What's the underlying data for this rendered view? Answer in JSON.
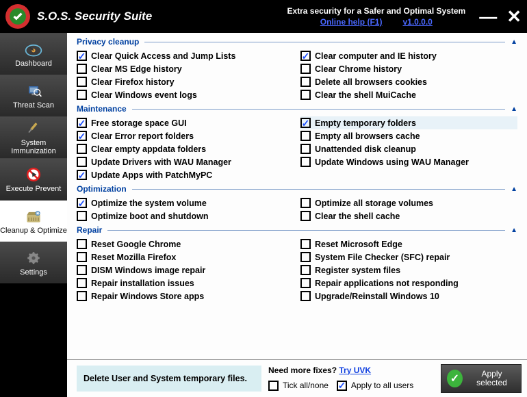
{
  "title": "S.O.S. Security Suite",
  "tagline": "Extra security for a Safer and Optimal System",
  "help_link": "Online help (F1)",
  "version": "v1.0.0.0",
  "sidebar": [
    {
      "label": "Dashboard"
    },
    {
      "label": "Threat Scan"
    },
    {
      "label": "System Immunization"
    },
    {
      "label": "Execute Prevent"
    },
    {
      "label": "Cleanup & Optimize"
    },
    {
      "label": "Settings"
    }
  ],
  "sections": {
    "privacy": {
      "title": "Privacy cleanup",
      "left": [
        {
          "label": "Clear Quick Access and Jump Lists",
          "checked": true
        },
        {
          "label": "Clear MS Edge history",
          "checked": false
        },
        {
          "label": "Clear Firefox history",
          "checked": false
        },
        {
          "label": "Clear Windows event logs",
          "checked": false
        }
      ],
      "right": [
        {
          "label": "Clear computer and IE history",
          "checked": true
        },
        {
          "label": "Clear Chrome history",
          "checked": false
        },
        {
          "label": "Delete all browsers cookies",
          "checked": false
        },
        {
          "label": "Clear the shell MuiCache",
          "checked": false
        }
      ]
    },
    "maintenance": {
      "title": "Maintenance",
      "left": [
        {
          "label": "Free storage space GUI",
          "checked": true
        },
        {
          "label": "Clear Error report folders",
          "checked": true
        },
        {
          "label": "Clear empty appdata folders",
          "checked": false
        },
        {
          "label": "Update Drivers with WAU Manager",
          "checked": false
        },
        {
          "label": "Update Apps with PatchMyPC",
          "checked": true
        }
      ],
      "right": [
        {
          "label": "Empty temporary folders",
          "checked": true,
          "hover": true
        },
        {
          "label": "Empty all browsers cache",
          "checked": false
        },
        {
          "label": "Unattended disk cleanup",
          "checked": false
        },
        {
          "label": "Update Windows using WAU Manager",
          "checked": false
        }
      ]
    },
    "optimization": {
      "title": "Optimization",
      "left": [
        {
          "label": "Optimize the system volume",
          "checked": true
        },
        {
          "label": "Optimize boot and shutdown",
          "checked": false
        }
      ],
      "right": [
        {
          "label": "Optimize all storage volumes",
          "checked": false
        },
        {
          "label": "Clear the shell cache",
          "checked": false
        }
      ]
    },
    "repair": {
      "title": "Repair",
      "left": [
        {
          "label": "Reset Google Chrome",
          "checked": false
        },
        {
          "label": "Reset Mozilla Firefox",
          "checked": false
        },
        {
          "label": "DISM Windows image repair",
          "checked": false
        },
        {
          "label": "Repair installation issues",
          "checked": false
        },
        {
          "label": "Repair Windows Store apps",
          "checked": false
        }
      ],
      "right": [
        {
          "label": "Reset Microsoft Edge",
          "checked": false
        },
        {
          "label": "System File Checker (SFC) repair",
          "checked": false
        },
        {
          "label": "Register system files",
          "checked": false
        },
        {
          "label": "Repair applications not responding",
          "checked": false
        },
        {
          "label": "Upgrade/Reinstall Windows 10",
          "checked": false
        }
      ]
    }
  },
  "footer": {
    "tip": "Delete User and System temporary files.",
    "need_fixes": "Need more fixes? ",
    "try_uvk": "Try UVK",
    "tick_all": "Tick all/none",
    "apply_users": "Apply to all users",
    "apply_btn": "Apply selected"
  }
}
